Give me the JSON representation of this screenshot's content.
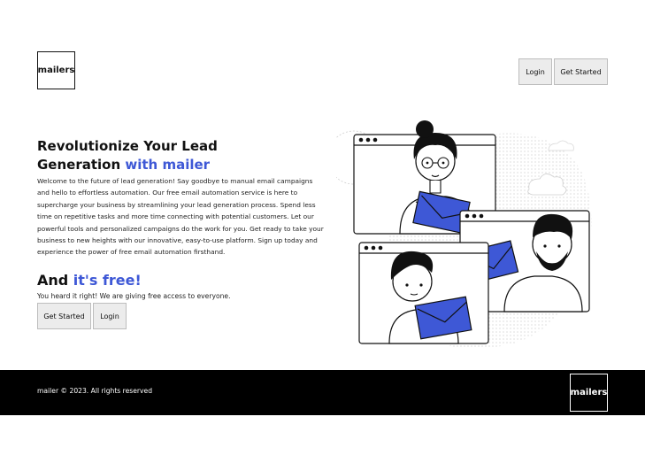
{
  "header": {
    "logo_text": "mailers",
    "login_label": "Login",
    "get_started_label": "Get Started"
  },
  "hero": {
    "title_part1": "Revolutionize Your Lead Generation ",
    "title_accent": "with mailer",
    "description": "Welcome to the future of lead generation! Say goodbye to manual email campaigns and hello to effortless automation. Our free email automation service is here to supercharge your business by streamlining your lead generation process. Spend less time on repetitive tasks and more time connecting with potential customers. Let our powerful tools and personalized campaigns do the work for you. Get ready to take your business to new heights with our innovative, easy-to-use platform. Sign up today and experience the power of free email automation firsthand.",
    "free_heading_part1": "And ",
    "free_heading_accent": "it's free!",
    "free_subtext": "You heard it right! We are giving free access to everyone.",
    "get_started_label": "Get Started",
    "login_label": "Login"
  },
  "illustration": {
    "icon": "video-call-people-with-envelopes-illustration"
  },
  "footer": {
    "copyright": "mailer © 2023. All rights reserved",
    "logo_text": "mailers"
  },
  "colors": {
    "accent": "#3e58d6",
    "footer_bg": "#000000",
    "button_bg": "#ececec"
  }
}
